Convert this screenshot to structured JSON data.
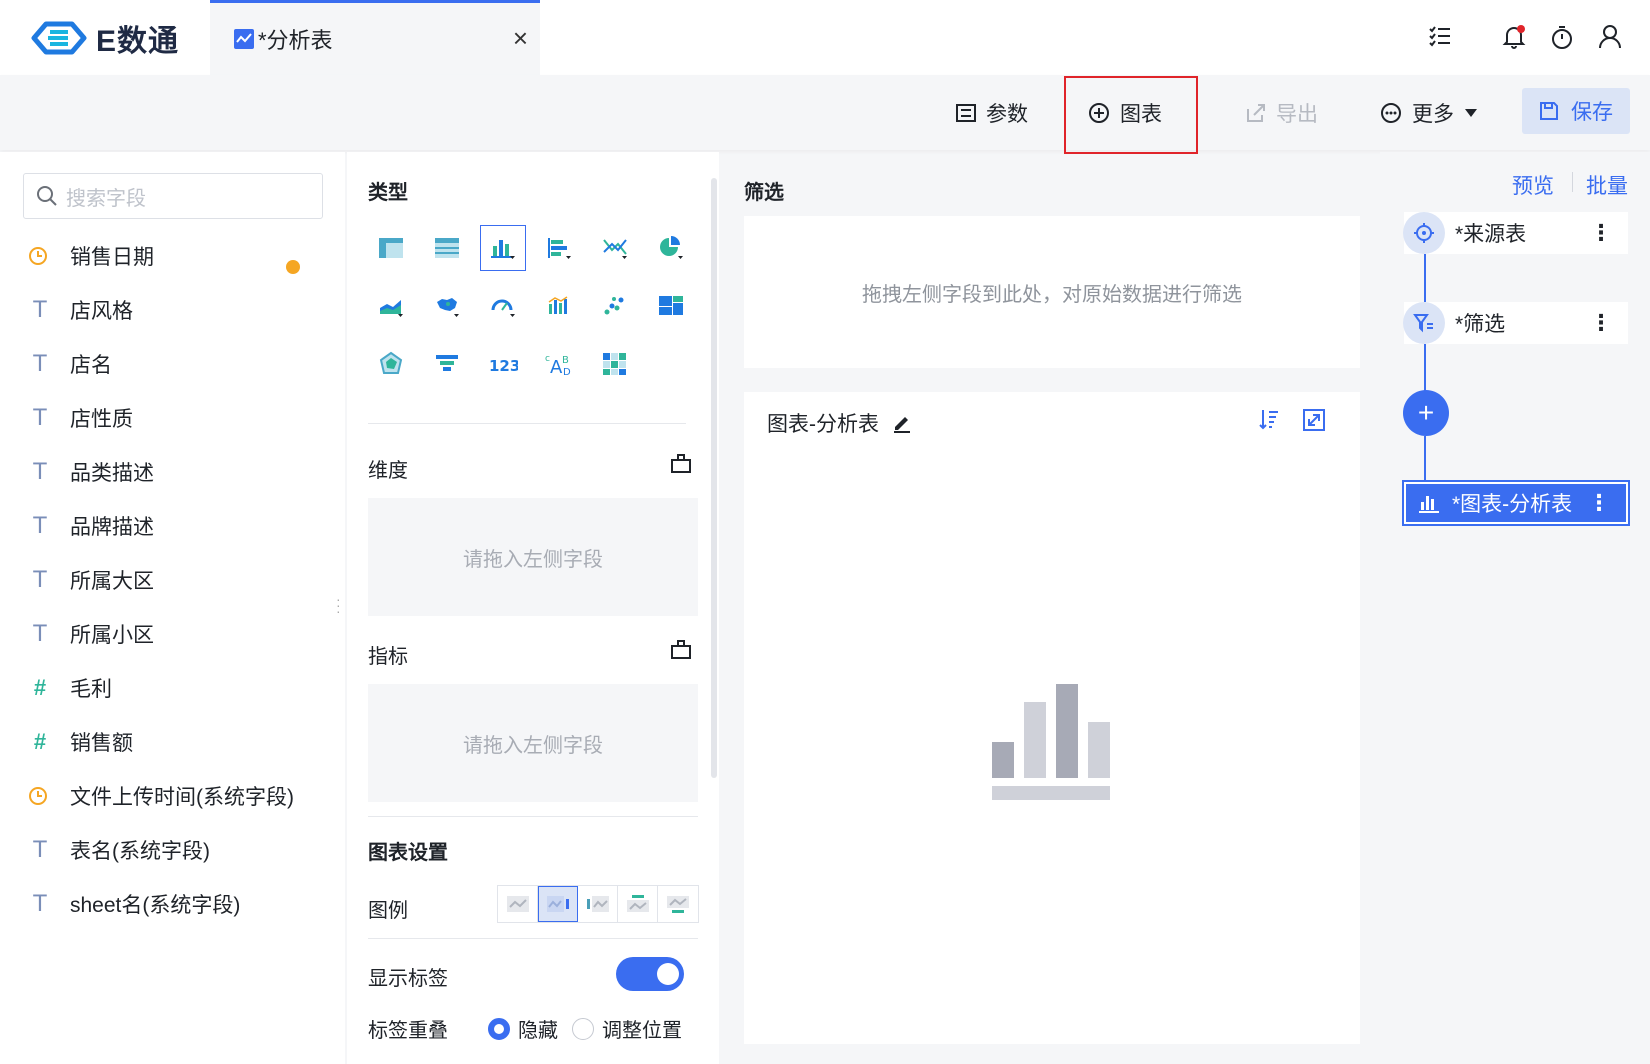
{
  "app": {
    "logo_text": "E数通"
  },
  "tab": {
    "label": "*分析表",
    "close": "×"
  },
  "toolbar": {
    "params_label": "参数",
    "chart_label": "图表",
    "export_label": "导出",
    "more_label": "更多",
    "save_label": "保存"
  },
  "fields": {
    "search_placeholder": "搜索字段",
    "items": [
      {
        "type": "date",
        "label": "销售日期"
      },
      {
        "type": "text",
        "label": "店风格"
      },
      {
        "type": "text",
        "label": "店名"
      },
      {
        "type": "text",
        "label": "店性质"
      },
      {
        "type": "text",
        "label": "品类描述"
      },
      {
        "type": "text",
        "label": "品牌描述"
      },
      {
        "type": "text",
        "label": "所属大区"
      },
      {
        "type": "text",
        "label": "所属小区"
      },
      {
        "type": "number",
        "label": "毛利"
      },
      {
        "type": "number",
        "label": "销售额"
      },
      {
        "type": "date",
        "label": "文件上传时间(系统字段)"
      },
      {
        "type": "text",
        "label": "表名(系统字段)"
      },
      {
        "type": "text",
        "label": "sheet名(系统字段)"
      }
    ]
  },
  "config": {
    "type_title": "类型",
    "chart_types": [
      "pivot-table",
      "detail-table",
      "bar-chart",
      "stacked-bar-chart",
      "line-chart",
      "pie-chart",
      "area-chart",
      "map-chart",
      "gauge-chart",
      "combo-chart",
      "scatter-chart",
      "treemap-chart",
      "radar-chart",
      "funnel-chart",
      "kpi-number",
      "word-cloud",
      "heatmap-chart"
    ],
    "selected_type": "bar-chart",
    "dimension_title": "维度",
    "dimension_placeholder": "请拖入左侧字段",
    "metric_title": "指标",
    "metric_placeholder": "请拖入左侧字段",
    "settings_title": "图表设置",
    "legend_label": "图例",
    "show_label_label": "显示标签",
    "show_label_on": true,
    "overlap_label": "标签重叠",
    "overlap_options": [
      "隐藏",
      "调整位置"
    ],
    "overlap_selected": "隐藏"
  },
  "filter": {
    "title": "筛选",
    "placeholder": "拖拽左侧字段到此处，对原始数据进行筛选"
  },
  "chart": {
    "title": "图表-分析表"
  },
  "pipeline": {
    "preview_label": "预览",
    "batch_label": "批量",
    "nodes": [
      "*来源表",
      "*筛选"
    ],
    "active_node": "*图表-分析表",
    "more": "⋮",
    "add": "+"
  },
  "colors": {
    "accent": "#3a6df0",
    "highlight_border": "#e0242a",
    "date_icon": "#f5a623",
    "number_icon": "#2fb59a"
  }
}
